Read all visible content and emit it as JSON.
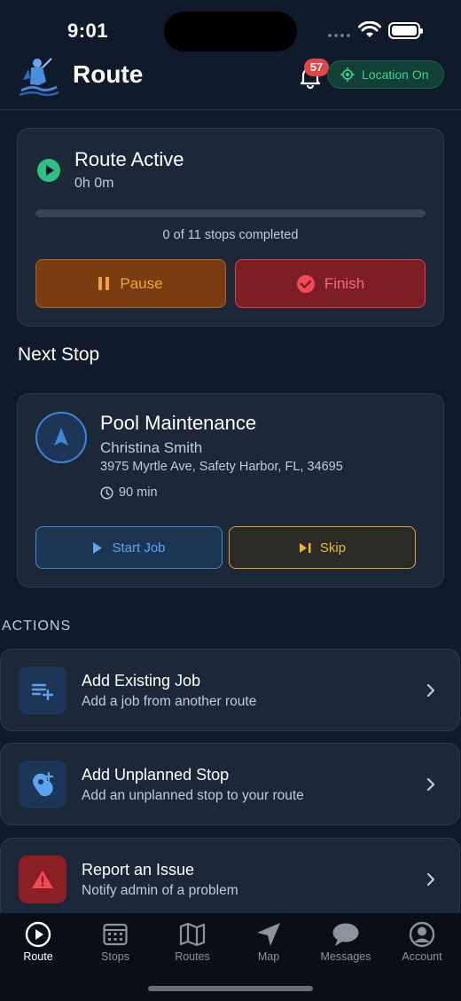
{
  "status_bar": {
    "time": "9:01"
  },
  "header": {
    "title": "Route",
    "notification_count": "57",
    "location_label": "Location On"
  },
  "active_route": {
    "title": "Route Active",
    "elapsed": "0h 0m",
    "progress_fraction": 0,
    "progress_text": "0 of 11 stops completed",
    "pause_label": "Pause",
    "finish_label": "Finish"
  },
  "next_stop": {
    "section_title": "Next Stop",
    "title": "Pool Maintenance",
    "customer": "Christina Smith",
    "address": "3975 Myrtle Ave, Safety Harbor, FL, 34695",
    "duration": "90 min",
    "start_label": "Start Job",
    "skip_label": "Skip"
  },
  "actions": {
    "section_title": "ACTIONS",
    "items": [
      {
        "title": "Add Existing Job",
        "subtitle": "Add a job from another route",
        "icon": "playlist-add-icon"
      },
      {
        "title": "Add Unplanned Stop",
        "subtitle": "Add an unplanned stop to your route",
        "icon": "add-location-icon"
      },
      {
        "title": "Report an Issue",
        "subtitle": "Notify admin of a problem",
        "icon": "warning-icon"
      }
    ]
  },
  "tabs": [
    {
      "label": "Route",
      "icon": "play-circle-icon",
      "active": true
    },
    {
      "label": "Stops",
      "icon": "calendar-grid-icon",
      "active": false
    },
    {
      "label": "Routes",
      "icon": "map-folded-icon",
      "active": false
    },
    {
      "label": "Map",
      "icon": "navigation-arrow-icon",
      "active": false
    },
    {
      "label": "Messages",
      "icon": "chat-bubble-icon",
      "active": false
    },
    {
      "label": "Account",
      "icon": "account-circle-icon",
      "active": false
    }
  ],
  "colors": {
    "background": "#0f1a2b",
    "card": "#1c2738",
    "success": "#3ed18f",
    "warning": "#f2a33b",
    "danger": "#d8414a",
    "primary": "#3f85d8"
  }
}
